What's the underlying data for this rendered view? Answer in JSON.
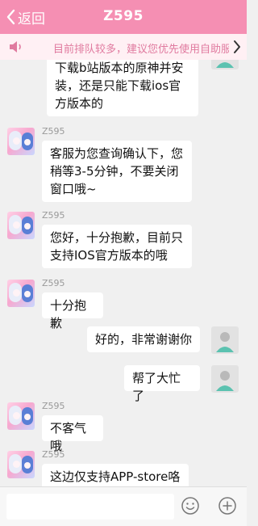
{
  "header": {
    "back_label": "返回",
    "title": "Z595"
  },
  "notice": {
    "text": "目前排队较多，建议您优先使用自助服务"
  },
  "messages": [
    {
      "from": "user-partial",
      "text_lines": [
        "下载b站版本的原神并安",
        "装，还是只能下载ios官",
        "方版本的"
      ]
    },
    {
      "from": "agent",
      "name": "Z595",
      "text_lines": [
        "客服为您查询确认下，您",
        "稍等3-5分钟，不要关闭",
        "窗口哦~"
      ]
    },
    {
      "from": "agent",
      "name": "Z595",
      "text_lines": [
        "您好，十分抱歉，目前只",
        "支持IOS官方版本的哦"
      ]
    },
    {
      "from": "agent",
      "name": "Z595",
      "text_lines": [
        "十分抱歉"
      ]
    },
    {
      "from": "user",
      "text_lines": [
        "好的，非常谢谢你"
      ]
    },
    {
      "from": "user",
      "text_lines": [
        "帮了大忙了"
      ]
    },
    {
      "from": "agent",
      "name": "Z595",
      "text_lines": [
        "不客气哦"
      ]
    },
    {
      "from": "agent",
      "name": "Z595",
      "text_lines": [
        "这边仅支持APP-store咯"
      ]
    }
  ],
  "colors": {
    "header": "#f58fb3",
    "notice_bg": "#fff0f4",
    "notice_text": "#e07a9f"
  },
  "icons": [
    "chevron-left-icon",
    "speaker-icon",
    "chevron-right-icon",
    "emoji-icon",
    "plus-icon"
  ]
}
